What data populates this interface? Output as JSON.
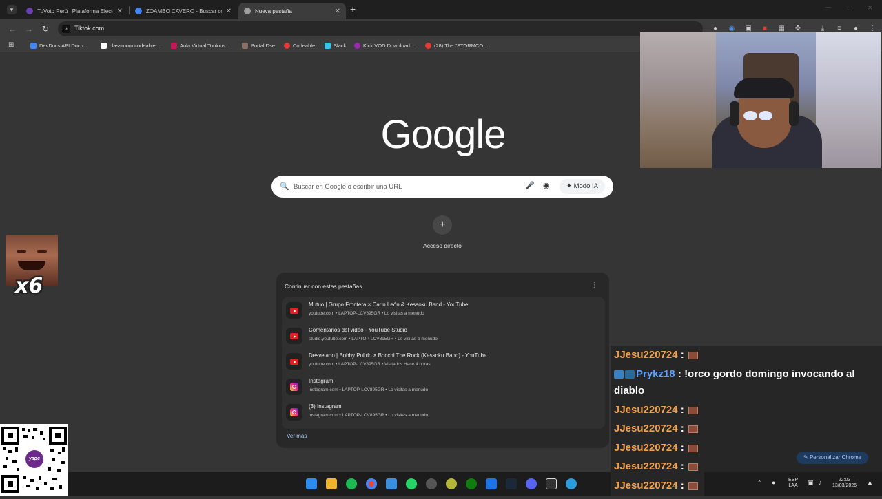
{
  "tabs": [
    {
      "title": "TuVoto Perú | Plataforma Electo",
      "color": "#6b3fb3"
    },
    {
      "title": "ZOAMBO CAVERO - Buscar con",
      "color": "#4285f4"
    },
    {
      "title": "Nueva pestaña",
      "color": "#9e9e9e"
    }
  ],
  "tab_close": "✕",
  "new_tab": "+",
  "tab_list_icon": "▾",
  "window_controls": {
    "minimize": "—",
    "maximize": "▢",
    "close": "✕"
  },
  "toolbar": {
    "back": "←",
    "forward": "→",
    "reload": "↻",
    "url": "Tiktok.com",
    "menu": "⋮"
  },
  "bookmarks": [
    {
      "label": "DevDocs API Docu...",
      "color": "#4285f4"
    },
    {
      "label": "classroom.codeable....",
      "color": "#ffffff"
    },
    {
      "label": "Aula Virtual Toulous...",
      "color": "#c2185b"
    },
    {
      "label": "Portal Dse",
      "color": "#8d6e63"
    },
    {
      "label": "Codeable",
      "color": "#e53935"
    },
    {
      "label": "Slack",
      "color": "#36c5f0"
    },
    {
      "label": "Kick VOD Download...",
      "color": "#9c27b0"
    },
    {
      "label": "(28) The \"STORMCO...",
      "color": "#e53935"
    }
  ],
  "google": {
    "logo": "Google",
    "search_placeholder": "Buscar en Google o escribir una URL",
    "modo_ia": "Modo IA",
    "shortcut_plus": "+",
    "shortcut_label": "Acceso directo"
  },
  "continue_card": {
    "heading": "Continuar con estas pestañas",
    "menu": "⋮",
    "items": [
      {
        "title": "Mutuo | Grupo Frontera × Carin León & Kessoku Band - YouTube",
        "meta": "youtube.com • LAPTOP-LCV895GR • Lo visitas a menudo",
        "icon": "youtube"
      },
      {
        "title": "Comentarios del video - YouTube Studio",
        "meta": "studio.youtube.com • LAPTOP-LCV895GR • Lo visitas a menudo",
        "icon": "youtube"
      },
      {
        "title": "Desvelado | Bobby Pulido × Bocchi The Rock (Kessoku Band) - YouTube",
        "meta": "youtube.com • LAPTOP-LCV895GR • Visitados Hace 4 horas",
        "icon": "youtube"
      },
      {
        "title": "Instagram",
        "meta": "instagram.com • LAPTOP-LCV895GR • Lo visitas a menudo",
        "icon": "instagram"
      },
      {
        "title": "(3) Instagram",
        "meta": "instagram.com • LAPTOP-LCV895GR • Lo visitas a menudo",
        "icon": "instagram"
      }
    ],
    "ver_mas": "Ver más"
  },
  "emote": {
    "multiplier": "x6"
  },
  "chat": [
    {
      "user": "JJesu220724",
      "text": ""
    },
    {
      "user": "Prykz18",
      "text": "!orco gordo domingo invocando al",
      "cont": "diablo"
    },
    {
      "user": "JJesu220724",
      "text": ""
    },
    {
      "user": "JJesu220724",
      "text": ""
    },
    {
      "user": "JJesu220724",
      "text": ""
    },
    {
      "user": "JJesu220724",
      "text": ""
    },
    {
      "user": "JJesu220724",
      "text": ""
    }
  ],
  "chat_separator": " : ",
  "personalize": "Personalizar Chrome",
  "qr": {
    "brand": "yape"
  },
  "tray": {
    "lang1": "ESP",
    "lang2": "LAA",
    "time": "22:03",
    "date": "13/03/2026"
  }
}
